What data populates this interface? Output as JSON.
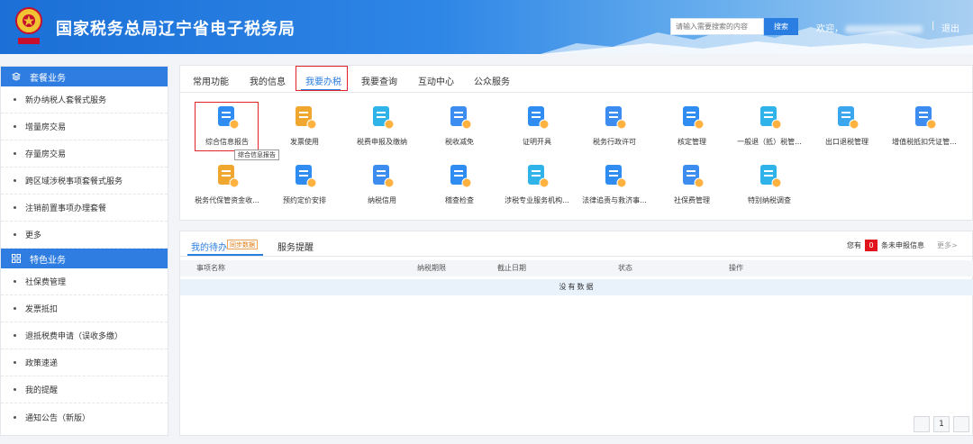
{
  "header": {
    "title": "国家税务总局辽宁省电子税务局",
    "search_placeholder": "请输入需要搜索的内容",
    "search_button": "搜索",
    "welcome": "欢迎，",
    "separator": "|",
    "logout": "退出"
  },
  "sidebar": {
    "sections": [
      {
        "title": "套餐业务",
        "icon": "layers-icon",
        "items": [
          "新办纳税人套餐式服务",
          "增量房交易",
          "存量房交易",
          "跨区域涉税事项套餐式服务",
          "注销前置事项办理套餐",
          "更多"
        ]
      },
      {
        "title": "特色业务",
        "icon": "grid-icon",
        "items": [
          "社保费管理",
          "发票抵扣",
          "退抵税费申请（误收多缴）",
          "政策速递",
          "我的提醒",
          "通知公告（新版）"
        ]
      }
    ]
  },
  "tabs": [
    "常用功能",
    "我的信息",
    "我要办税",
    "我要查询",
    "互动中心",
    "公众服务"
  ],
  "active_tab": "我要办税",
  "functions": [
    {
      "label": "综合信息报告",
      "icon": "report-icon"
    },
    {
      "label": "发票使用",
      "icon": "invoice-icon"
    },
    {
      "label": "税费申报及缴纳",
      "icon": "tax-declare-icon"
    },
    {
      "label": "税收减免",
      "icon": "tax-relief-icon"
    },
    {
      "label": "证明开具",
      "icon": "certificate-icon"
    },
    {
      "label": "税务行政许可",
      "icon": "license-icon"
    },
    {
      "label": "核定管理",
      "icon": "approval-icon"
    },
    {
      "label": "一般退（抵）税管...",
      "icon": "refund-icon"
    },
    {
      "label": "出口退税管理",
      "icon": "export-refund-icon"
    },
    {
      "label": "增值税抵扣凭证管...",
      "icon": "vat-icon"
    },
    {
      "label": "税务代保管资金收...",
      "icon": "custody-fund-icon"
    },
    {
      "label": "预约定价安排",
      "icon": "pricing-icon"
    },
    {
      "label": "纳税信用",
      "icon": "credit-icon"
    },
    {
      "label": "稽查检查",
      "icon": "inspection-icon"
    },
    {
      "label": "涉税专业服务机构...",
      "icon": "agency-icon"
    },
    {
      "label": "法律追责与救济事...",
      "icon": "legal-icon"
    },
    {
      "label": "社保费管理",
      "icon": "social-security-icon"
    },
    {
      "label": "特别纳税调查",
      "icon": "special-survey-icon"
    }
  ],
  "tooltip": "综合信息报告",
  "todo": {
    "tab_pending": "我的待办",
    "sync_badge": "同步数据",
    "tab_reminder": "服务提醒",
    "summary_prefix": "您有",
    "count": "0",
    "summary_suffix": "条未申报信息",
    "more": "更多>",
    "columns": [
      "事项名称",
      "纳税期限",
      "截止日期",
      "状态",
      "操作"
    ],
    "empty": "没有数据",
    "page": "1"
  },
  "colors": {
    "primary": "#2a7de1",
    "highlight": "#e0242a"
  }
}
